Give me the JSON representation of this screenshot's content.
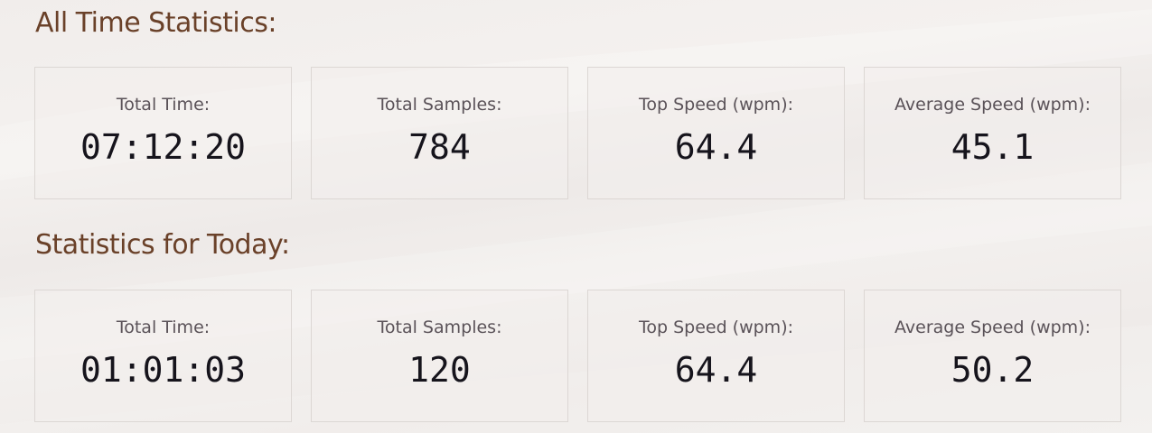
{
  "sections": [
    {
      "title": "All Time Statistics:",
      "stats": [
        {
          "label": "Total Time:",
          "value": "07:12:20"
        },
        {
          "label": "Total Samples:",
          "value": "784"
        },
        {
          "label": "Top Speed (wpm):",
          "value": "64.4"
        },
        {
          "label": "Average Speed (wpm):",
          "value": "45.1"
        }
      ]
    },
    {
      "title": "Statistics for Today:",
      "stats": [
        {
          "label": "Total Time:",
          "value": "01:01:03"
        },
        {
          "label": "Total Samples:",
          "value": "120"
        },
        {
          "label": "Top Speed (wpm):",
          "value": "64.4"
        },
        {
          "label": "Average Speed (wpm):",
          "value": "50.2"
        }
      ]
    }
  ],
  "colors": {
    "title": "#6a4129",
    "label": "#5a5258",
    "value": "#16141c",
    "card_border": "#dcd7d4",
    "background": "#f1edeb"
  }
}
